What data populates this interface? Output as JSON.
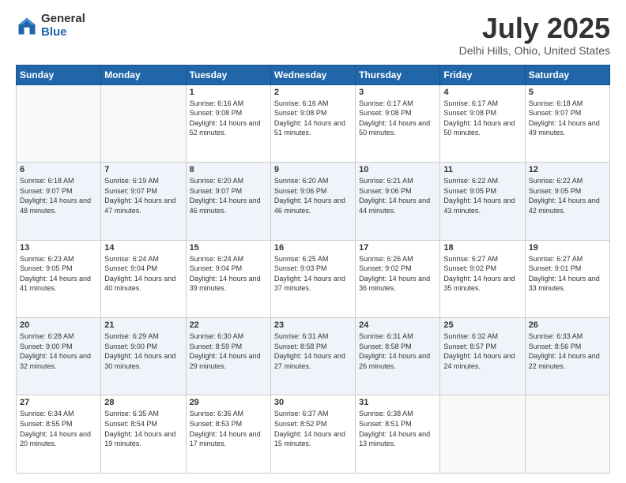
{
  "logo": {
    "general": "General",
    "blue": "Blue"
  },
  "header": {
    "title": "July 2025",
    "subtitle": "Delhi Hills, Ohio, United States"
  },
  "weekdays": [
    "Sunday",
    "Monday",
    "Tuesday",
    "Wednesday",
    "Thursday",
    "Friday",
    "Saturday"
  ],
  "weeks": [
    [
      {
        "day": "",
        "sunrise": "",
        "sunset": "",
        "daylight": ""
      },
      {
        "day": "",
        "sunrise": "",
        "sunset": "",
        "daylight": ""
      },
      {
        "day": "1",
        "sunrise": "Sunrise: 6:16 AM",
        "sunset": "Sunset: 9:08 PM",
        "daylight": "Daylight: 14 hours and 52 minutes."
      },
      {
        "day": "2",
        "sunrise": "Sunrise: 6:16 AM",
        "sunset": "Sunset: 9:08 PM",
        "daylight": "Daylight: 14 hours and 51 minutes."
      },
      {
        "day": "3",
        "sunrise": "Sunrise: 6:17 AM",
        "sunset": "Sunset: 9:08 PM",
        "daylight": "Daylight: 14 hours and 50 minutes."
      },
      {
        "day": "4",
        "sunrise": "Sunrise: 6:17 AM",
        "sunset": "Sunset: 9:08 PM",
        "daylight": "Daylight: 14 hours and 50 minutes."
      },
      {
        "day": "5",
        "sunrise": "Sunrise: 6:18 AM",
        "sunset": "Sunset: 9:07 PM",
        "daylight": "Daylight: 14 hours and 49 minutes."
      }
    ],
    [
      {
        "day": "6",
        "sunrise": "Sunrise: 6:18 AM",
        "sunset": "Sunset: 9:07 PM",
        "daylight": "Daylight: 14 hours and 48 minutes."
      },
      {
        "day": "7",
        "sunrise": "Sunrise: 6:19 AM",
        "sunset": "Sunset: 9:07 PM",
        "daylight": "Daylight: 14 hours and 47 minutes."
      },
      {
        "day": "8",
        "sunrise": "Sunrise: 6:20 AM",
        "sunset": "Sunset: 9:07 PM",
        "daylight": "Daylight: 14 hours and 46 minutes."
      },
      {
        "day": "9",
        "sunrise": "Sunrise: 6:20 AM",
        "sunset": "Sunset: 9:06 PM",
        "daylight": "Daylight: 14 hours and 46 minutes."
      },
      {
        "day": "10",
        "sunrise": "Sunrise: 6:21 AM",
        "sunset": "Sunset: 9:06 PM",
        "daylight": "Daylight: 14 hours and 44 minutes."
      },
      {
        "day": "11",
        "sunrise": "Sunrise: 6:22 AM",
        "sunset": "Sunset: 9:05 PM",
        "daylight": "Daylight: 14 hours and 43 minutes."
      },
      {
        "day": "12",
        "sunrise": "Sunrise: 6:22 AM",
        "sunset": "Sunset: 9:05 PM",
        "daylight": "Daylight: 14 hours and 42 minutes."
      }
    ],
    [
      {
        "day": "13",
        "sunrise": "Sunrise: 6:23 AM",
        "sunset": "Sunset: 9:05 PM",
        "daylight": "Daylight: 14 hours and 41 minutes."
      },
      {
        "day": "14",
        "sunrise": "Sunrise: 6:24 AM",
        "sunset": "Sunset: 9:04 PM",
        "daylight": "Daylight: 14 hours and 40 minutes."
      },
      {
        "day": "15",
        "sunrise": "Sunrise: 6:24 AM",
        "sunset": "Sunset: 9:04 PM",
        "daylight": "Daylight: 14 hours and 39 minutes."
      },
      {
        "day": "16",
        "sunrise": "Sunrise: 6:25 AM",
        "sunset": "Sunset: 9:03 PM",
        "daylight": "Daylight: 14 hours and 37 minutes."
      },
      {
        "day": "17",
        "sunrise": "Sunrise: 6:26 AM",
        "sunset": "Sunset: 9:02 PM",
        "daylight": "Daylight: 14 hours and 36 minutes."
      },
      {
        "day": "18",
        "sunrise": "Sunrise: 6:27 AM",
        "sunset": "Sunset: 9:02 PM",
        "daylight": "Daylight: 14 hours and 35 minutes."
      },
      {
        "day": "19",
        "sunrise": "Sunrise: 6:27 AM",
        "sunset": "Sunset: 9:01 PM",
        "daylight": "Daylight: 14 hours and 33 minutes."
      }
    ],
    [
      {
        "day": "20",
        "sunrise": "Sunrise: 6:28 AM",
        "sunset": "Sunset: 9:00 PM",
        "daylight": "Daylight: 14 hours and 32 minutes."
      },
      {
        "day": "21",
        "sunrise": "Sunrise: 6:29 AM",
        "sunset": "Sunset: 9:00 PM",
        "daylight": "Daylight: 14 hours and 30 minutes."
      },
      {
        "day": "22",
        "sunrise": "Sunrise: 6:30 AM",
        "sunset": "Sunset: 8:59 PM",
        "daylight": "Daylight: 14 hours and 29 minutes."
      },
      {
        "day": "23",
        "sunrise": "Sunrise: 6:31 AM",
        "sunset": "Sunset: 8:58 PM",
        "daylight": "Daylight: 14 hours and 27 minutes."
      },
      {
        "day": "24",
        "sunrise": "Sunrise: 6:31 AM",
        "sunset": "Sunset: 8:58 PM",
        "daylight": "Daylight: 14 hours and 26 minutes."
      },
      {
        "day": "25",
        "sunrise": "Sunrise: 6:32 AM",
        "sunset": "Sunset: 8:57 PM",
        "daylight": "Daylight: 14 hours and 24 minutes."
      },
      {
        "day": "26",
        "sunrise": "Sunrise: 6:33 AM",
        "sunset": "Sunset: 8:56 PM",
        "daylight": "Daylight: 14 hours and 22 minutes."
      }
    ],
    [
      {
        "day": "27",
        "sunrise": "Sunrise: 6:34 AM",
        "sunset": "Sunset: 8:55 PM",
        "daylight": "Daylight: 14 hours and 20 minutes."
      },
      {
        "day": "28",
        "sunrise": "Sunrise: 6:35 AM",
        "sunset": "Sunset: 8:54 PM",
        "daylight": "Daylight: 14 hours and 19 minutes."
      },
      {
        "day": "29",
        "sunrise": "Sunrise: 6:36 AM",
        "sunset": "Sunset: 8:53 PM",
        "daylight": "Daylight: 14 hours and 17 minutes."
      },
      {
        "day": "30",
        "sunrise": "Sunrise: 6:37 AM",
        "sunset": "Sunset: 8:52 PM",
        "daylight": "Daylight: 14 hours and 15 minutes."
      },
      {
        "day": "31",
        "sunrise": "Sunrise: 6:38 AM",
        "sunset": "Sunset: 8:51 PM",
        "daylight": "Daylight: 14 hours and 13 minutes."
      },
      {
        "day": "",
        "sunrise": "",
        "sunset": "",
        "daylight": ""
      },
      {
        "day": "",
        "sunrise": "",
        "sunset": "",
        "daylight": ""
      }
    ]
  ]
}
